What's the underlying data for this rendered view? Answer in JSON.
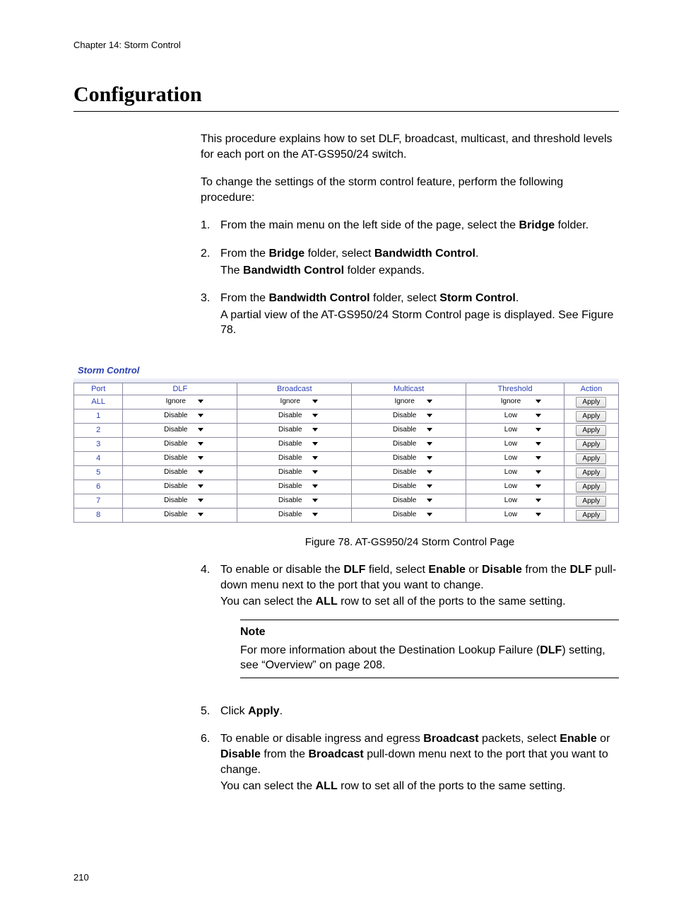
{
  "chapter": "Chapter 14: Storm Control",
  "title": "Configuration",
  "intro1": "This procedure explains how to set DLF, broadcast, multicast, and threshold levels for each port on the AT-GS950/24 switch.",
  "intro2": "To change the settings of the storm control feature, perform the following procedure:",
  "steps": {
    "s1": {
      "n": "1.",
      "a": "From the main menu on the left side of the page, select the ",
      "b": "Bridge",
      "c": " folder."
    },
    "s2": {
      "n": "2.",
      "a": "From the ",
      "b": "Bridge",
      "c": " folder, select ",
      "d": "Bandwidth Control",
      "e": ".",
      "sub_a": "The ",
      "sub_b": "Bandwidth Control",
      "sub_c": " folder expands."
    },
    "s3": {
      "n": "3.",
      "a": "From the ",
      "b": "Bandwidth Control",
      "c": " folder, select ",
      "d": "Storm Control",
      "e": ".",
      "sub": "A partial view of the AT-GS950/24 Storm Control page is displayed. See Figure 78."
    },
    "s4": {
      "n": "4.",
      "a": "To enable or disable the ",
      "b": "DLF",
      "c": " field, select ",
      "d": "Enable",
      "e": " or ",
      "f": "Disable",
      "g": " from the ",
      "h": "DLF",
      "i": " pull-down menu next to the port that you want to change.",
      "sub_a": "You can select the ",
      "sub_b": "ALL",
      "sub_c": " row to set all of the ports to the same setting."
    },
    "s5": {
      "n": "5.",
      "a": "Click ",
      "b": "Apply",
      "c": "."
    },
    "s6": {
      "n": "6.",
      "a": "To enable or disable ingress and egress ",
      "b": "Broadcast",
      "c": " packets, select ",
      "d": "Enable",
      "e": " or ",
      "f": "Disable",
      "g": " from the ",
      "h": "Broadcast",
      "i": " pull-down menu next to the port that you want to change.",
      "sub_a": "You can select the ",
      "sub_b": "ALL",
      "sub_c": " row to set all of the ports to the same setting."
    }
  },
  "note": {
    "head": "Note",
    "a": "For more information about the Destination Lookup Failure (",
    "b": "DLF",
    "c": ") setting, see “Overview” on page 208."
  },
  "figure": {
    "panel_title": "Storm Control",
    "caption": "Figure 78. AT-GS950/24 Storm Control Page",
    "headers": {
      "port": "Port",
      "dlf": "DLF",
      "broadcast": "Broadcast",
      "multicast": "Multicast",
      "threshold": "Threshold",
      "action": "Action"
    },
    "apply_label": "Apply",
    "rows": [
      {
        "port": "ALL",
        "dlf": "Ignore",
        "broadcast": "Ignore",
        "multicast": "Ignore",
        "threshold": "Ignore"
      },
      {
        "port": "1",
        "dlf": "Disable",
        "broadcast": "Disable",
        "multicast": "Disable",
        "threshold": "Low"
      },
      {
        "port": "2",
        "dlf": "Disable",
        "broadcast": "Disable",
        "multicast": "Disable",
        "threshold": "Low"
      },
      {
        "port": "3",
        "dlf": "Disable",
        "broadcast": "Disable",
        "multicast": "Disable",
        "threshold": "Low"
      },
      {
        "port": "4",
        "dlf": "Disable",
        "broadcast": "Disable",
        "multicast": "Disable",
        "threshold": "Low"
      },
      {
        "port": "5",
        "dlf": "Disable",
        "broadcast": "Disable",
        "multicast": "Disable",
        "threshold": "Low"
      },
      {
        "port": "6",
        "dlf": "Disable",
        "broadcast": "Disable",
        "multicast": "Disable",
        "threshold": "Low"
      },
      {
        "port": "7",
        "dlf": "Disable",
        "broadcast": "Disable",
        "multicast": "Disable",
        "threshold": "Low"
      },
      {
        "port": "8",
        "dlf": "Disable",
        "broadcast": "Disable",
        "multicast": "Disable",
        "threshold": "Low"
      }
    ]
  },
  "page_number": "210"
}
